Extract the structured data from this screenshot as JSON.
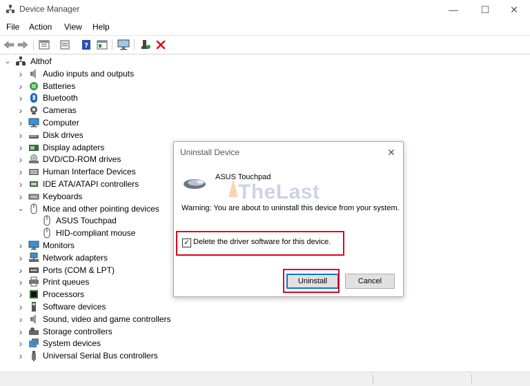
{
  "window": {
    "title": "Device Manager",
    "minimize": "—",
    "maximize": "☐",
    "close": "✕"
  },
  "menu": {
    "items": [
      "File",
      "Action",
      "View",
      "Help"
    ]
  },
  "tree": {
    "root": "Althof",
    "items": [
      {
        "label": "Audio inputs and outputs",
        "icon": "speaker-icon"
      },
      {
        "label": "Batteries",
        "icon": "battery-icon"
      },
      {
        "label": "Bluetooth",
        "icon": "bluetooth-icon"
      },
      {
        "label": "Cameras",
        "icon": "camera-icon"
      },
      {
        "label": "Computer",
        "icon": "computer-icon"
      },
      {
        "label": "Disk drives",
        "icon": "disk-drive-icon"
      },
      {
        "label": "Display adapters",
        "icon": "display-adapter-icon"
      },
      {
        "label": "DVD/CD-ROM drives",
        "icon": "dvd-drive-icon"
      },
      {
        "label": "Human Interface Devices",
        "icon": "hid-icon"
      },
      {
        "label": "IDE ATA/ATAPI controllers",
        "icon": "ide-controller-icon"
      },
      {
        "label": "Keyboards",
        "icon": "keyboard-icon"
      },
      {
        "label": "Mice and other pointing devices",
        "icon": "mouse-icon",
        "expanded": true
      },
      {
        "label": "ASUS Touchpad",
        "icon": "mouse-icon",
        "child": true
      },
      {
        "label": "HID-compliant mouse",
        "icon": "mouse-icon",
        "child": true
      },
      {
        "label": "Monitors",
        "icon": "monitor-icon"
      },
      {
        "label": "Network adapters",
        "icon": "network-adapter-icon"
      },
      {
        "label": "Ports (COM & LPT)",
        "icon": "port-icon"
      },
      {
        "label": "Print queues",
        "icon": "printer-icon"
      },
      {
        "label": "Processors",
        "icon": "processor-icon"
      },
      {
        "label": "Software devices",
        "icon": "software-device-icon"
      },
      {
        "label": "Sound, video and game controllers",
        "icon": "sound-controller-icon"
      },
      {
        "label": "Storage controllers",
        "icon": "storage-controller-icon"
      },
      {
        "label": "System devices",
        "icon": "system-devices-icon"
      },
      {
        "label": "Universal Serial Bus controllers",
        "icon": "usb-icon"
      }
    ]
  },
  "dialog": {
    "title": "Uninstall Device",
    "device_name": "ASUS Touchpad",
    "watermark": "TheLast",
    "warning": "Warning: You are about to uninstall this device from your system.",
    "checkbox_label": "Delete the driver software for this device.",
    "checkbox_checked": true,
    "uninstall_label": "Uninstall",
    "cancel_label": "Cancel"
  },
  "colors": {
    "highlight": "#e0001a",
    "accent": "#0078d7",
    "watermark": "#1a3c8e"
  }
}
